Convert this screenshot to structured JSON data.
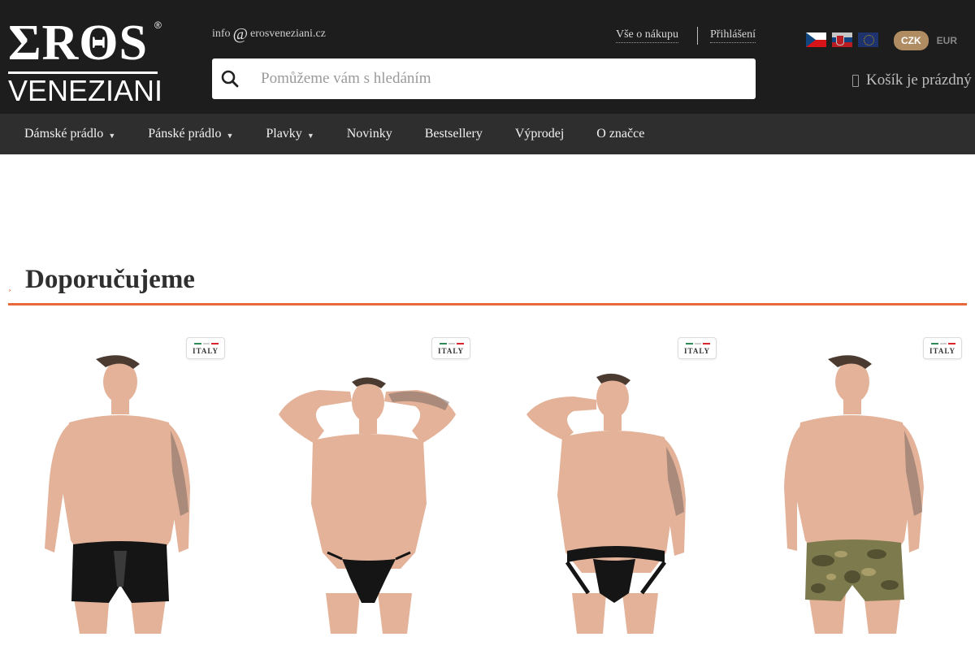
{
  "header": {
    "logo_top": "ΣRΘS",
    "logo_reg": "®",
    "logo_bottom": "VENEZIANI",
    "email_prefix": "info",
    "email_at": "@",
    "email_domain": "erosveneziani.cz",
    "links": {
      "about_shopping": "Vše o nákupu",
      "login": "Přihlášení"
    },
    "languages": [
      "cz-flag",
      "sk-flag",
      "eu-flag"
    ],
    "currency": {
      "active": "CZK",
      "inactive": "EUR"
    },
    "search": {
      "placeholder": "Pomůžeme vám s hledáním",
      "value": ""
    },
    "cart": {
      "label": "Košík je prázdný"
    }
  },
  "nav": {
    "items": [
      {
        "label": "Dámské prádlo",
        "has_dropdown": true
      },
      {
        "label": "Pánské prádlo",
        "has_dropdown": true
      },
      {
        "label": "Plavky",
        "has_dropdown": true
      },
      {
        "label": "Novinky",
        "has_dropdown": false
      },
      {
        "label": "Bestsellery",
        "has_dropdown": false
      },
      {
        "label": "Výprodej",
        "has_dropdown": false
      },
      {
        "label": "O značce",
        "has_dropdown": false
      }
    ],
    "caret": "▼"
  },
  "section": {
    "mark": "¸",
    "title": "Doporučujeme"
  },
  "products": [
    {
      "badge": "ITALY",
      "garment": "black shiny boxer briefs",
      "garment_color": "#151515"
    },
    {
      "badge": "ITALY",
      "garment": "black thong",
      "garment_color": "#151515"
    },
    {
      "badge": "ITALY",
      "garment": "black jockstrap",
      "garment_color": "#151515"
    },
    {
      "badge": "ITALY",
      "garment": "camouflage boxer briefs",
      "garment_color": "#7d7a4d"
    }
  ],
  "colors": {
    "header_bg": "#1c1d1c",
    "nav_bg": "#2d2e2d",
    "accent": "#e8683a",
    "currency_active": "#b08c62",
    "skin": "#e3b299"
  }
}
